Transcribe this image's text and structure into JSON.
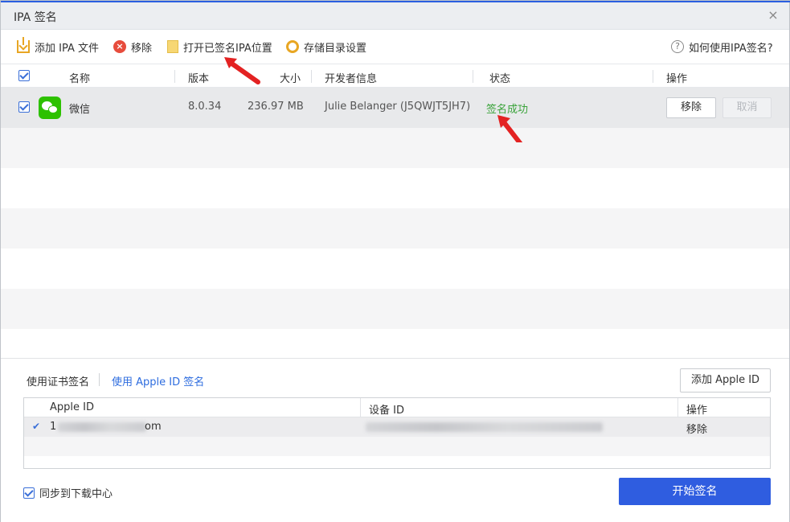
{
  "window": {
    "title": "IPA 签名",
    "close_glyph": "×"
  },
  "toolbar": {
    "add_ipa": "添加 IPA 文件",
    "remove": "移除",
    "open_location": "打开已签名IPA位置",
    "storage_settings": "存储目录设置",
    "help": "如何使用IPA签名?"
  },
  "table": {
    "columns": [
      "名称",
      "版本",
      "大小",
      "开发者信息",
      "状态",
      "操作"
    ],
    "rows": [
      {
        "checked": true,
        "icon": "wechat-icon",
        "name": "微信",
        "version": "8.0.34",
        "size": "236.97 MB",
        "developer": "Julie Belanger (J5QWJT5JH7)",
        "status": "签名成功",
        "action_remove": "移除",
        "action_cancel": "取消"
      }
    ]
  },
  "signing": {
    "tab_certificate": "使用证书签名",
    "tab_apple_id": "使用 Apple ID 签名",
    "add_apple_id": "添加 Apple ID",
    "columns": [
      "Apple ID",
      "设备 ID",
      "操作"
    ],
    "rows": [
      {
        "selected": true,
        "apple_id_visible_suffix": "om",
        "apple_id_visible_prefix": "1",
        "action": "移除"
      }
    ]
  },
  "footer": {
    "sync_label": "同步到下载中心",
    "sync_checked": true,
    "start_button": "开始签名"
  },
  "colors": {
    "accent": "#2f5de0",
    "success": "#3aa33a",
    "link": "#2d6cdf",
    "annotation_arrow": "#e32222"
  }
}
